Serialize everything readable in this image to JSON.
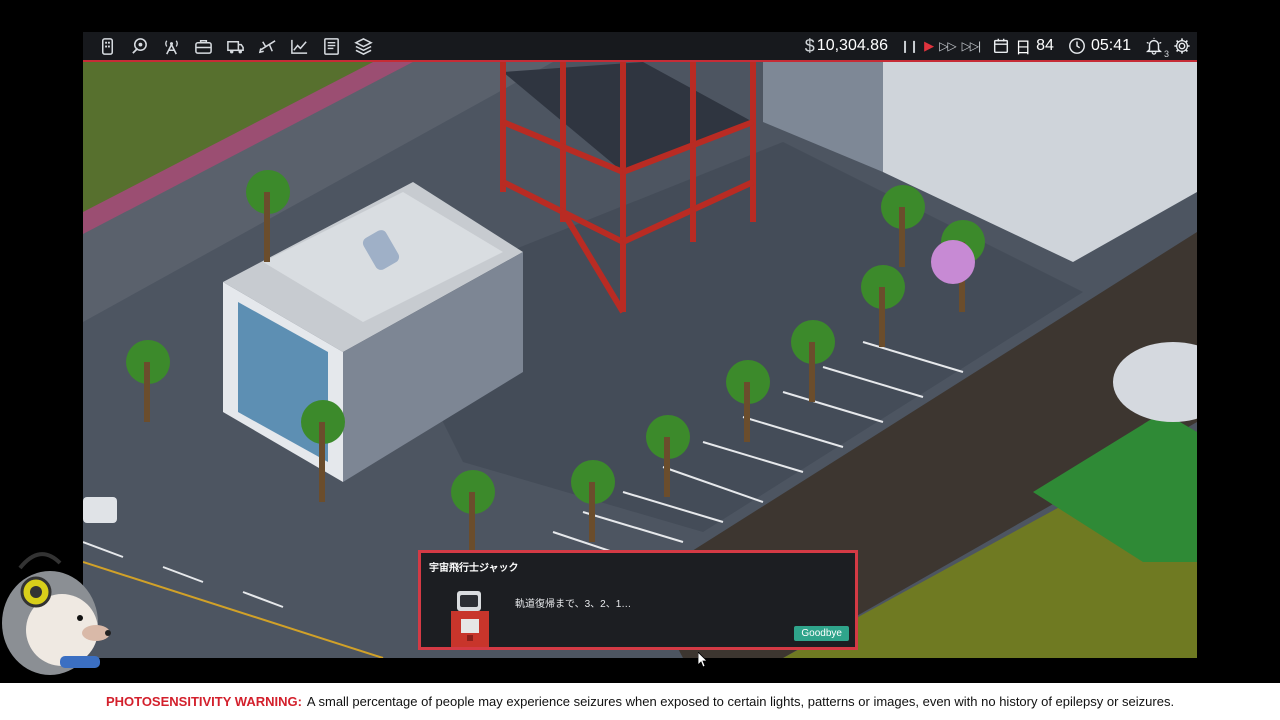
{
  "toolbar": {
    "icons": [
      "phone-icon",
      "places-icon",
      "broadcast-icon",
      "briefcase-icon",
      "delivery-icon",
      "flights-icon",
      "stats-icon",
      "book-icon",
      "layers-icon"
    ]
  },
  "status": {
    "currency_symbol": "$",
    "money": "10,304.86",
    "day_label": "日",
    "day_number": "84",
    "time": "05:41",
    "notifications": "3",
    "speed_controls": [
      "pause",
      "play",
      "fast",
      "fastest"
    ]
  },
  "dialog": {
    "speaker": "宇宙飛行士ジャック",
    "message": "軌道復帰まで、3、2、1…",
    "button": "Goodbye"
  },
  "warning": {
    "label": "PHOTOSENSITIVITY WARNING:",
    "text": "A small percentage of people may experience seizures when exposed to certain lights, patterns or images, even with no history of epilepsy or seizures."
  },
  "colors": {
    "accent_red": "#d43a45",
    "button_green": "#2fa48b",
    "topbar_bg": "#17191d"
  }
}
